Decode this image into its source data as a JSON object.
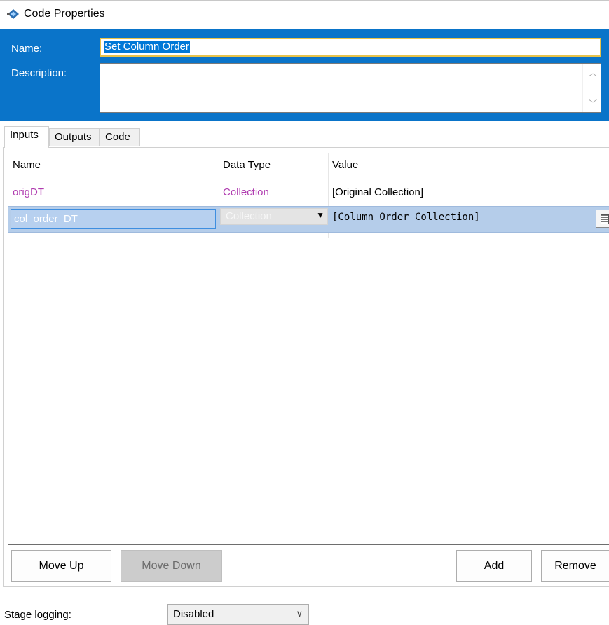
{
  "window": {
    "title": "Code Properties",
    "icon": "code-stage-icon"
  },
  "header": {
    "name_label": "Name:",
    "name_value": "Set Column Order",
    "description_label": "Description:",
    "description_value": "",
    "bg_color": "#0a74c9"
  },
  "tabs": [
    {
      "label": "Inputs",
      "active": true
    },
    {
      "label": "Outputs",
      "active": false
    },
    {
      "label": "Code",
      "active": false
    }
  ],
  "grid": {
    "columns": [
      "Name",
      "Data Type",
      "Value"
    ],
    "rows": [
      {
        "name": "origDT",
        "data_type": "Collection",
        "value": "[Original Collection]"
      },
      {
        "name": "col_order_DT",
        "data_type": "Collection",
        "value": "[Column Order Collection]",
        "selected": true
      }
    ]
  },
  "buttons": {
    "move_up": "Move Up",
    "move_down": "Move Down",
    "add": "Add",
    "remove": "Remove"
  },
  "stage_logging": {
    "label": "Stage logging:",
    "value": "Disabled"
  }
}
